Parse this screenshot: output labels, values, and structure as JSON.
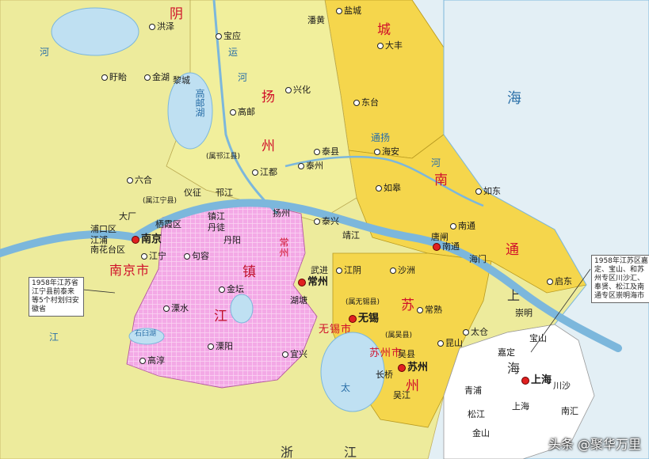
{
  "colors": {
    "sea": "#e3eff5",
    "yellow": "#f5d64c",
    "pale": "#edeb9c",
    "pink": "#f3a9e6",
    "river": "#7cb7dc"
  },
  "regions": [
    {
      "key": "yancheng1",
      "text": "阴"
    },
    {
      "key": "yancheng2",
      "text": "城"
    },
    {
      "key": "yangzhou1",
      "text": "扬"
    },
    {
      "key": "yangzhou2",
      "text": "州"
    },
    {
      "key": "nantong1",
      "text": "南"
    },
    {
      "key": "nantong2",
      "text": "通"
    },
    {
      "key": "zhenjiang1",
      "text": "镇"
    },
    {
      "key": "zhenjiang2",
      "text": "江"
    },
    {
      "key": "suzhou1",
      "text": "苏"
    },
    {
      "key": "suzhou2",
      "text": "州"
    },
    {
      "key": "nanjing",
      "text": "南京市"
    },
    {
      "key": "changzhou",
      "text": "常州"
    },
    {
      "key": "wuxi",
      "text": "无锡市"
    },
    {
      "key": "suzhoushi",
      "text": "苏州市"
    }
  ],
  "places": [
    {
      "key": "hongze",
      "text": "洪泽"
    },
    {
      "key": "baoying",
      "text": "宝应"
    },
    {
      "key": "panhuang",
      "text": "潘黄"
    },
    {
      "key": "yancheng",
      "text": "盐城"
    },
    {
      "key": "dafeng",
      "text": "大丰"
    },
    {
      "key": "xuyi",
      "text": "盱眙"
    },
    {
      "key": "jinhu",
      "text": "金湖"
    },
    {
      "key": "lihua",
      "text": "黎城"
    },
    {
      "key": "xinghua",
      "text": "兴化"
    },
    {
      "key": "gaoyou",
      "text": "高邮"
    },
    {
      "key": "dongtai",
      "text": "东台"
    },
    {
      "key": "taixian",
      "text": "泰县"
    },
    {
      "key": "haian",
      "text": "海安"
    },
    {
      "key": "jiangdu",
      "text": "江都"
    },
    {
      "key": "taizhou",
      "text": "泰州"
    },
    {
      "key": "rugao",
      "text": "如皋"
    },
    {
      "key": "liuhe",
      "text": "六合"
    },
    {
      "key": "yizheng",
      "text": "仪征"
    },
    {
      "key": "hanjiang",
      "text": "邗江"
    },
    {
      "key": "rudong",
      "text": "如东"
    },
    {
      "key": "yangzhou",
      "text": "扬州"
    },
    {
      "key": "taixing",
      "text": "泰兴"
    },
    {
      "key": "jingjiang",
      "text": "靖江"
    },
    {
      "key": "nantong",
      "text": "南通"
    },
    {
      "key": "tangzha",
      "text": "唐闸"
    },
    {
      "key": "nantongc",
      "text": "南通"
    },
    {
      "key": "haimen",
      "text": "海门"
    },
    {
      "key": "qidong",
      "text": "启东"
    },
    {
      "key": "dachang",
      "text": "大厂"
    },
    {
      "key": "zhenjiang",
      "text": "镇江"
    },
    {
      "key": "dantu",
      "text": "丹徒"
    },
    {
      "key": "danyang",
      "text": "丹阳"
    },
    {
      "key": "pukou",
      "text": "浦口区"
    },
    {
      "key": "jiangpu",
      "text": "江浦"
    },
    {
      "key": "qixia",
      "text": "栖霞区"
    },
    {
      "key": "yuhua",
      "text": "南花台区"
    },
    {
      "key": "nanjing",
      "text": "南京"
    },
    {
      "key": "jiangning",
      "text": "江宁"
    },
    {
      "key": "jurong",
      "text": "句容"
    },
    {
      "key": "jintan",
      "text": "金坛"
    },
    {
      "key": "wujin",
      "text": "武进"
    },
    {
      "key": "changzhouc",
      "text": "常州"
    },
    {
      "key": "jiangyin",
      "text": "江阴"
    },
    {
      "key": "shazhou",
      "text": "沙洲"
    },
    {
      "key": "changshu",
      "text": "常熟"
    },
    {
      "key": "wuxic",
      "text": "无锡"
    },
    {
      "key": "hutang",
      "text": "湖塘"
    },
    {
      "key": "taicang",
      "text": "太仓"
    },
    {
      "key": "lishui",
      "text": "溧水"
    },
    {
      "key": "liyang",
      "text": "溧阳"
    },
    {
      "key": "yixing",
      "text": "宜兴"
    },
    {
      "key": "gaochun",
      "text": "高淳"
    },
    {
      "key": "kunshan",
      "text": "昆山"
    },
    {
      "key": "wuxian",
      "text": "吴县"
    },
    {
      "key": "suzhouc",
      "text": "苏州"
    },
    {
      "key": "wujiang",
      "text": "吴江"
    },
    {
      "key": "jiading",
      "text": "嘉定"
    },
    {
      "key": "baoshan",
      "text": "宝山"
    },
    {
      "key": "chuansha",
      "text": "川沙"
    },
    {
      "key": "shanghai",
      "text": "上海"
    },
    {
      "key": "qingpu",
      "text": "青浦"
    },
    {
      "key": "songjiang",
      "text": "松江"
    },
    {
      "key": "nanhui",
      "text": "南汇"
    },
    {
      "key": "jinshan",
      "text": "金山"
    },
    {
      "key": "chongming",
      "text": "崇明"
    },
    {
      "key": "shanghaixian",
      "text": "上海"
    },
    {
      "key": "changjiang",
      "text": "长桥"
    }
  ],
  "brackets": [
    {
      "key": "b1",
      "text": "(属邗江县)"
    },
    {
      "key": "b2",
      "text": "(属江宁县)"
    },
    {
      "key": "b3",
      "text": "(属无锡县)"
    },
    {
      "key": "b4",
      "text": "(属吴县)"
    }
  ],
  "water": [
    {
      "key": "gaoyouhu",
      "text": "高邮湖"
    },
    {
      "key": "taihu",
      "text": "太"
    },
    {
      "key": "shijiuhu",
      "text": "石臼湖"
    },
    {
      "key": "jiang1",
      "text": "江"
    },
    {
      "key": "yun1",
      "text": "运"
    },
    {
      "key": "yun2",
      "text": "河"
    },
    {
      "key": "tongyang",
      "text": "通扬"
    },
    {
      "key": "he1",
      "text": "河"
    },
    {
      "key": "he2",
      "text": "河"
    }
  ],
  "big": [
    {
      "key": "zhe",
      "text": "浙"
    },
    {
      "key": "jiang",
      "text": "江"
    },
    {
      "key": "hai",
      "text": "海"
    },
    {
      "key": "shang",
      "text": "上"
    },
    {
      "key": "hai2",
      "text": "海"
    }
  ],
  "notes": {
    "left": "1958年江苏省江宁县前泰来等5个村划归安徽省",
    "right": "1958年江苏区嘉定、宝山、和苏州专区川沙汇、奉贤、松江及南通专区崇明海市"
  },
  "watermark": "头条 @聚华万里"
}
